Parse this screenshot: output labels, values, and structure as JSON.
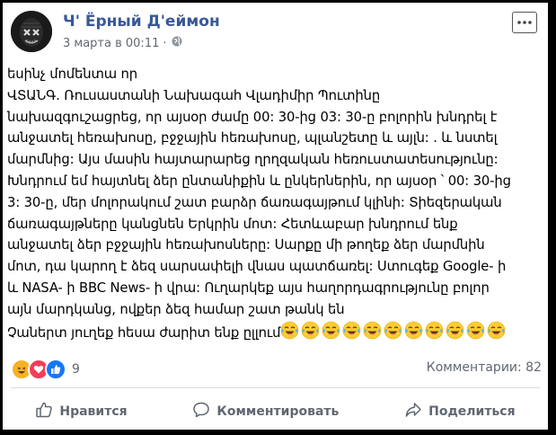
{
  "post": {
    "author": "Ч' Ёрный Д'еймон",
    "timestamp": "3 марта в 00:11",
    "separator": "·",
    "privacy_icon": "globe-icon",
    "lines": [
      "եսինչ մոմենտա որ",
      "ՎՏԱՆԳ. Ռուսաստանի Նախագահ Վլադիմիր Պուտինը",
      "նախազգուշացրեց, որ այսօր ժամը 00: 30-ից 03: 30-ը բոլորին խնդրել է",
      "անջատել հեռախոսը, բջջային հեռախոսը, պլանշետը և այլն: . և նստել",
      "մարմնից: Այս մասին հայտարարեց ղրղզական հեռուստատեսությունը:",
      "Խնդրում եմ հայտնել ձեր ընտանիքին և ընկերներին, որ այսօր ՝ 00: 30-ից",
      "3: 30-ը, մեր մոլորակում շատ բարձր ճառագայթում կլինի: Տիեզերական",
      "ճառագայթները կանցնեն Երկրին մոտ: Հետևաբար խնդրում ենք",
      "անջատել ձեր բջջային հեռախոսները: Սարքը մի թողեք ձեր մարմնին",
      "մոտ, դա կարող է ձեզ սարսափելի վնաս պատճառել: Ստուգեք Google- ի",
      "և NASA- ի BBC News- ի վրա: Ուղարկեք այս հաղորդագրությունը բոլոր",
      "այն մարդկանց, ովքեր ձեզ համար շատ թանկ են",
      "Չաներտ յուղեք հեսա ժարիտ ենք ըլլում"
    ],
    "trailing_emoji": {
      "name": "tears-of-joy-emoji",
      "count": 11
    }
  },
  "reactions": {
    "icons": [
      "haha-reaction-icon",
      "love-reaction-icon",
      "like-reaction-icon"
    ],
    "count": "9",
    "comments": "Комментарии: 82"
  },
  "actions": {
    "like": "Нравится",
    "comment": "Комментировать",
    "share": "Поделиться"
  },
  "colors": {
    "author": "#385898",
    "meta": "#616770",
    "like_blue": "#1877f2",
    "love_red": "#f33e58",
    "haha_yellow": "#f7b125"
  }
}
